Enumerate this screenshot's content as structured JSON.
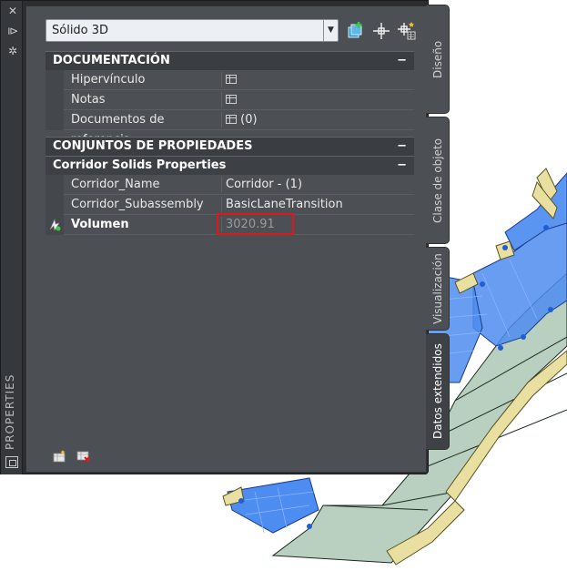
{
  "palette": {
    "title": "PROPERTIES",
    "object_type": "Sólido 3D",
    "tabs": [
      "Diseño",
      "Clase de objeto",
      "Visualización",
      "Datos extendidos"
    ],
    "active_tab": "Datos extendidos"
  },
  "sections": {
    "documentacion": {
      "title": "DOCUMENTACIÓN",
      "rows": [
        {
          "label": "Hipervínculo",
          "value": ""
        },
        {
          "label": "Notas",
          "value": ""
        },
        {
          "label": "Documentos de referencia",
          "value": "(0)"
        }
      ]
    },
    "conjuntos": {
      "title": "CONJUNTOS DE PROPIEDADES"
    },
    "corridor": {
      "title": "Corridor Solids Properties",
      "rows": [
        {
          "label": "Corridor_Name",
          "value": "Corridor - (1)"
        },
        {
          "label": "Corridor_Subassembly",
          "value": "BasicLaneTransition"
        },
        {
          "label": "Volumen",
          "value": "3020.91"
        }
      ]
    }
  },
  "collapse_symbol": "−",
  "icons": {
    "titlebar": [
      "close-icon",
      "auto-hide-icon",
      "settings-icon"
    ],
    "toolbar": [
      "add-to-selection-icon",
      "select-objects-icon",
      "quick-select-icon"
    ],
    "bottom": [
      "add-property-set-icon",
      "remove-property-set-icon"
    ]
  },
  "colors": {
    "highlight": "#e2151b",
    "viewport_blue": "#4d8cf0",
    "viewport_green": "#b9cfc0",
    "curb_yellow": "#e8dfa0"
  }
}
